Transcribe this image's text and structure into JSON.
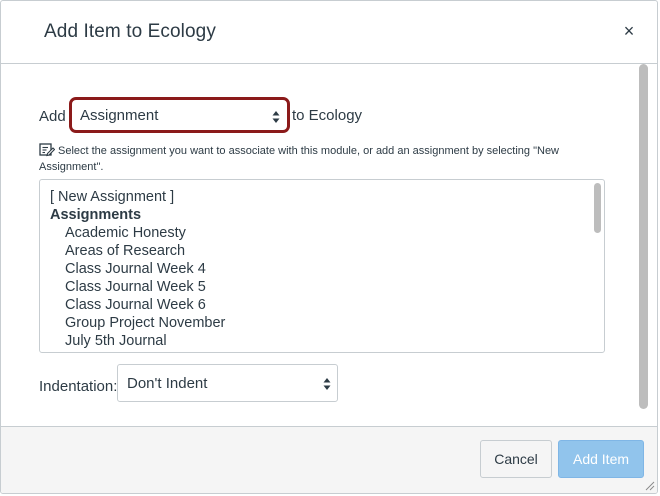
{
  "dialog": {
    "title": "Add Item to Ecology",
    "close_glyph": "×"
  },
  "form": {
    "add_label": "Add",
    "item_type_selected": "Assignment",
    "to_label": "to Ecology",
    "help_text": "Select the assignment you want to associate with this module, or add an assignment by selecting \"New Assignment\".",
    "help_icon": "edit-note-icon",
    "list": {
      "items": [
        "[ New Assignment ]",
        "Assignments",
        "Academic Honesty",
        "Areas of Research",
        "Class Journal Week 4",
        "Class Journal Week 5",
        "Class Journal Week 6",
        "Group Project November",
        "July 5th Journal"
      ]
    },
    "indentation_label": "Indentation:",
    "indentation_selected": "Don't Indent"
  },
  "footer": {
    "cancel_label": "Cancel",
    "add_label": "Add Item"
  },
  "colors": {
    "highlight_border": "#8b1a1a",
    "primary_button": "#91c4ec",
    "text": "#2d3b45"
  }
}
